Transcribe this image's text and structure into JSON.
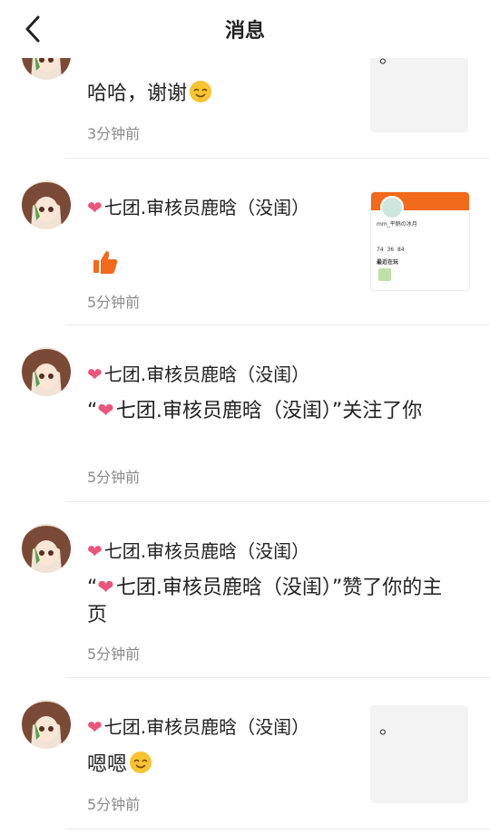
{
  "header": {
    "title": "消息"
  },
  "items": [
    {
      "name": "七团.审核员鹿晗（没闺）",
      "message": "哈哈，谢谢",
      "time": "3分钟前",
      "thumb_text": "。"
    },
    {
      "name": "七团.审核员鹿晗（没闺）",
      "message": "",
      "time": "5分钟前"
    },
    {
      "name": "七团.审核员鹿晗（没闺）",
      "message_prefix": "“",
      "message_name": "七团.审核员鹿晗（没闺）",
      "message_suffix": "”关注了你",
      "time": "5分钟前"
    },
    {
      "name": "七团.审核员鹿晗（没闺）",
      "message_prefix": "“",
      "message_name": "七团.审核员鹿晗（没闺）",
      "message_suffix": "”赞了你的主页",
      "time": "5分钟前"
    },
    {
      "name": "七团.审核员鹿晗（没闺）",
      "message": "嗯嗯",
      "time": "5分钟前",
      "thumb_text": "。"
    }
  ],
  "profile_thumb": {
    "username": "mm_平鹅の冰月",
    "section_label": "最近在玩",
    "stats": [
      "74",
      "36",
      "84"
    ]
  },
  "colors": {
    "heart": "#e8577b",
    "accent": "#f26a1b",
    "time": "#8a8a8a"
  }
}
